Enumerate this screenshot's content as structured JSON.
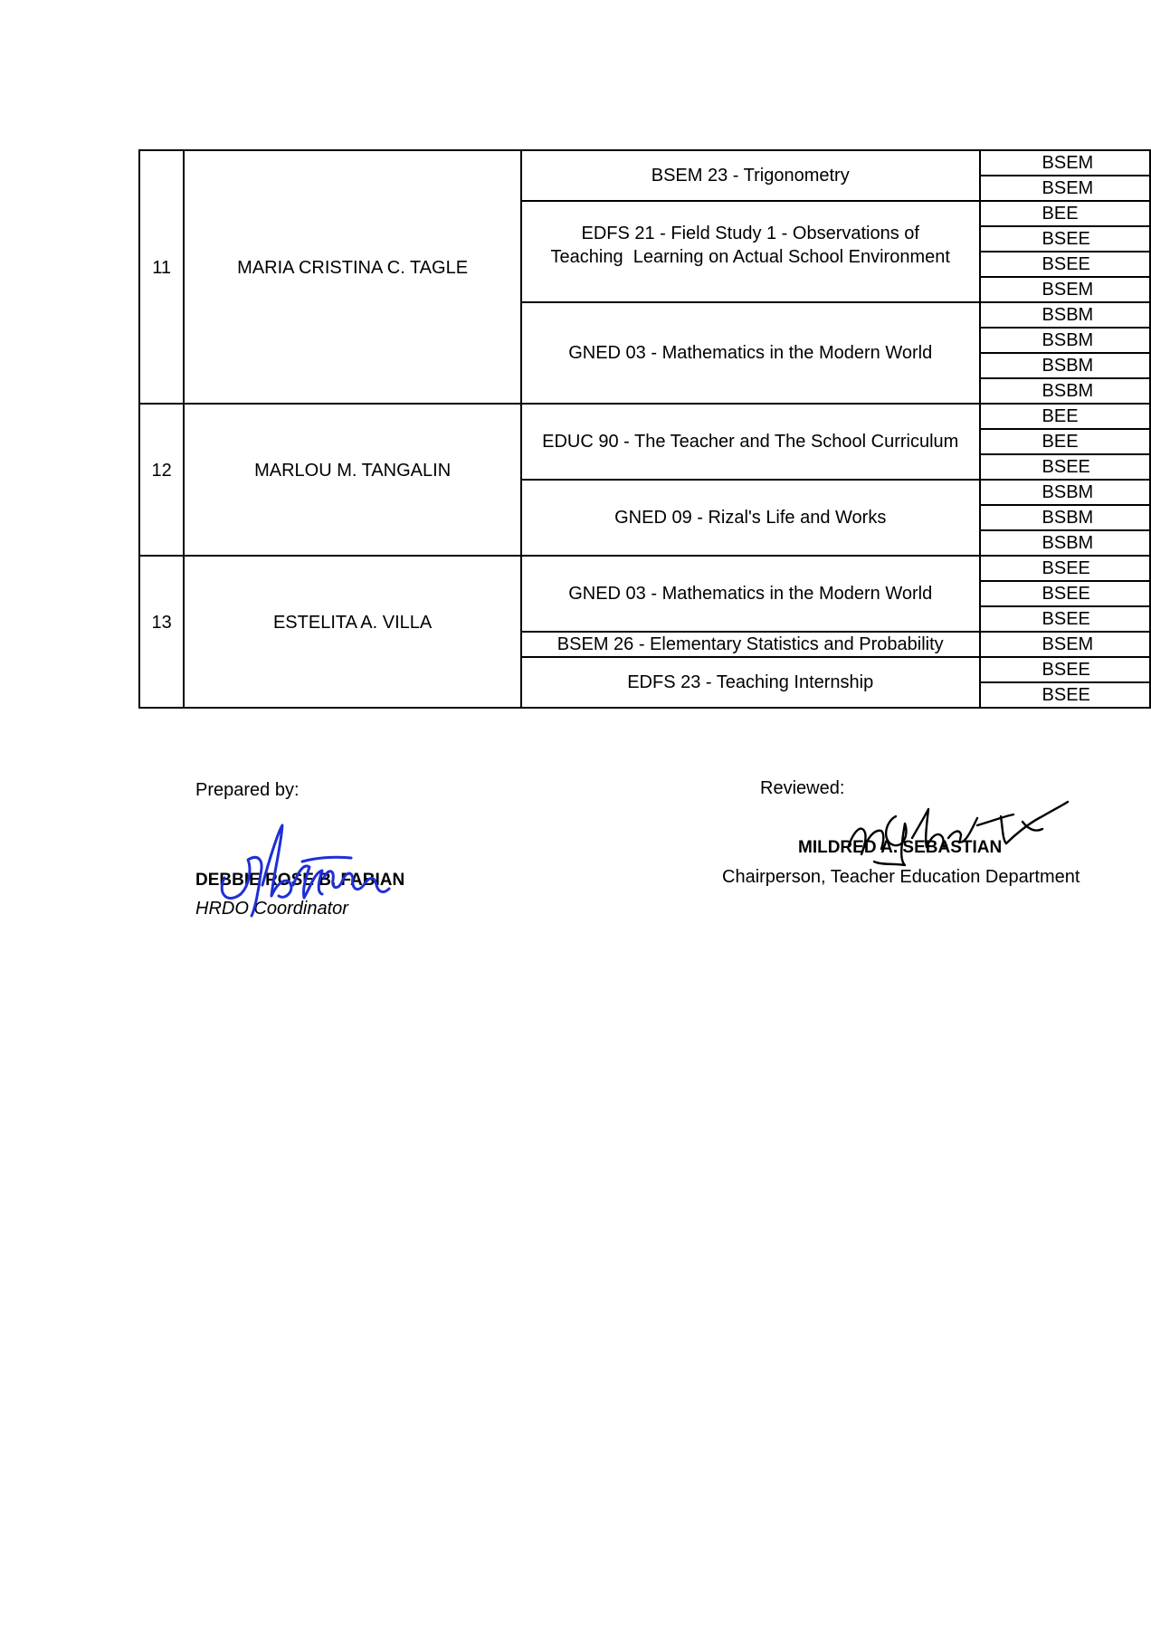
{
  "schedule": {
    "rows": [
      {
        "no": "11",
        "name": "MARIA CRISTINA C. TAGLE",
        "subjects": [
          {
            "title": "BSEM 23 - Trigonometry",
            "sections": [
              "BSEM",
              "BSEM"
            ]
          },
          {
            "title_lines": [
              "EDFS 21 - Field Study 1 - Observations of",
              "Teaching  Learning on Actual School Environment"
            ],
            "sections": [
              "BEE",
              "BSEE",
              "BSEE",
              "BSEM"
            ]
          },
          {
            "title": "GNED 03 - Mathematics in the Modern World",
            "sections": [
              "BSBM",
              "BSBM",
              "BSBM",
              "BSBM"
            ]
          }
        ]
      },
      {
        "no": "12",
        "name": "MARLOU M. TANGALIN",
        "subjects": [
          {
            "title": "EDUC 90 - The Teacher and The School Curriculum",
            "sections": [
              "BEE",
              "BEE",
              "BSEE"
            ]
          },
          {
            "title": "GNED 09 - Rizal's Life and Works",
            "sections": [
              "BSBM",
              "BSBM",
              "BSBM"
            ]
          }
        ]
      },
      {
        "no": "13",
        "name": "ESTELITA A. VILLA",
        "subjects": [
          {
            "title": "GNED 03 - Mathematics in the Modern World",
            "sections": [
              "BSEE",
              "BSEE",
              "BSEE"
            ]
          },
          {
            "title": "BSEM 26 - Elementary Statistics and Probability",
            "sections": [
              "BSEM"
            ]
          },
          {
            "title": "EDFS 23 - Teaching Internship",
            "sections": [
              "BSEE",
              "BSEE"
            ]
          }
        ]
      }
    ]
  },
  "signatories": {
    "prepared": {
      "label": "Prepared by:",
      "name": "DEBBIE ROSE B. FABIAN",
      "role": "HRDO Coordinator",
      "signature_text": "dbfabian",
      "ink_color": "#1f2fd6"
    },
    "reviewed": {
      "label": "Reviewed:",
      "name": "MILDRED A. SEBASTIAN",
      "role": "Chairperson, Teacher Education Department",
      "ink_color": "#000000"
    }
  }
}
